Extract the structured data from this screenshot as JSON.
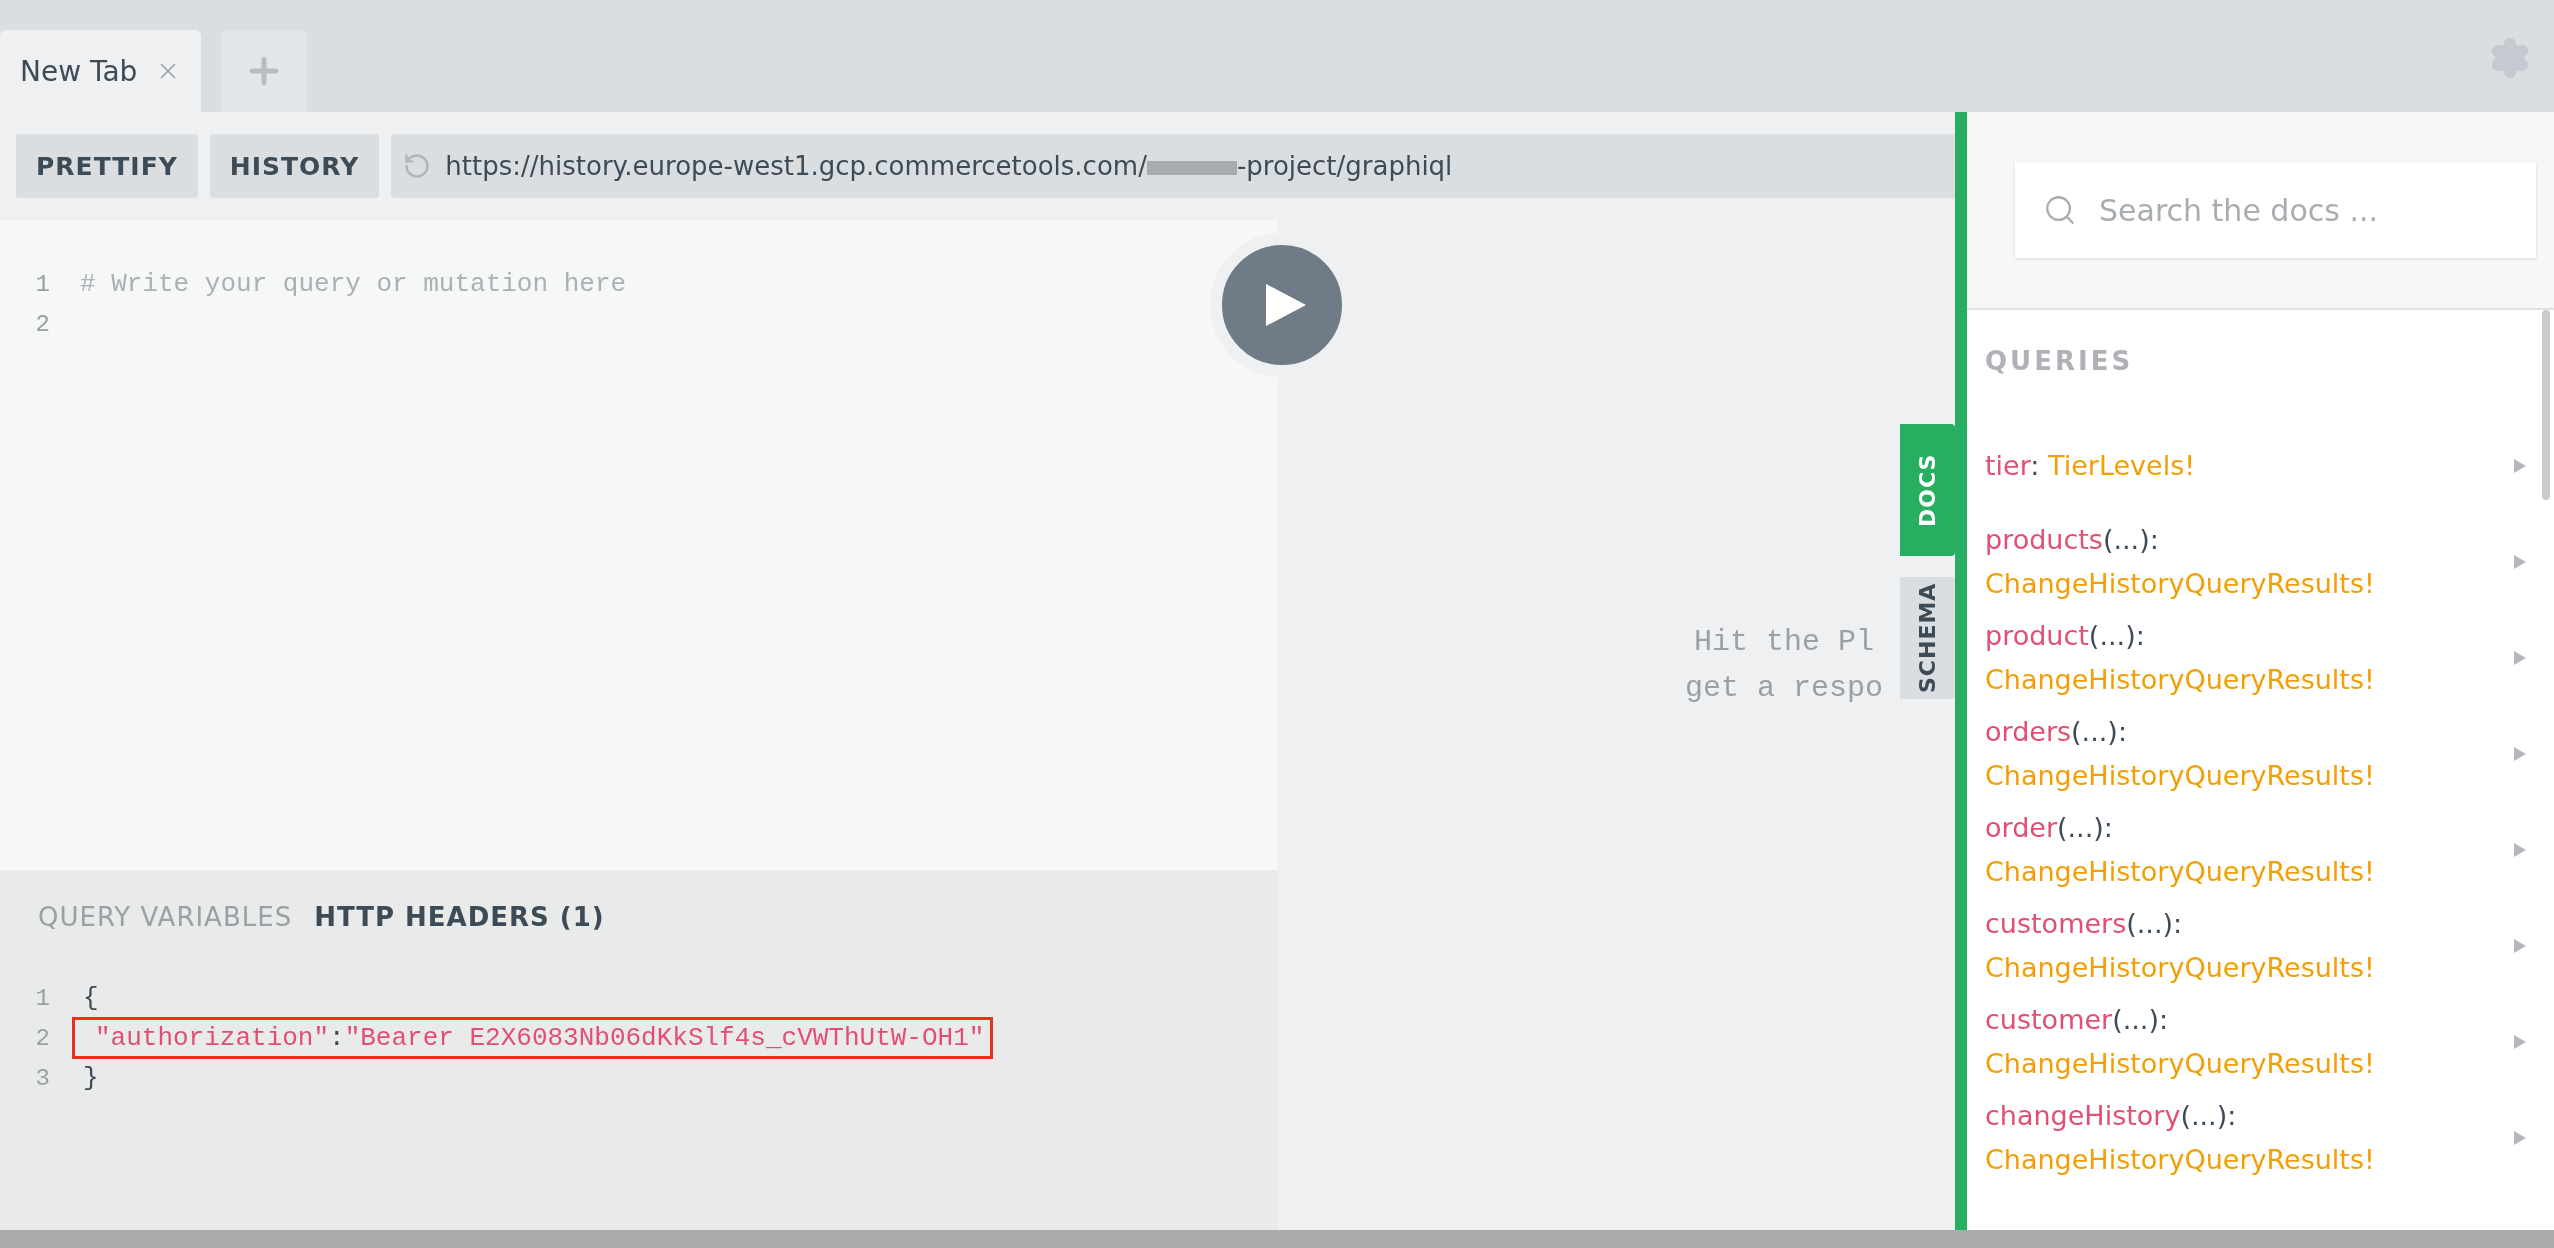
{
  "tabs": [
    {
      "label": "New Tab",
      "selected": true
    }
  ],
  "toolbar": {
    "buttons": [
      "PRETTIFY",
      "HISTORY"
    ],
    "url_start": "https://history.europe-west1.gcp.commercetools.com/",
    "url_end": "-project/graphiql"
  },
  "query_editor": {
    "lines": [
      {
        "number": "1",
        "text": "# Write your query or mutation here"
      },
      {
        "number": "2"
      }
    ]
  },
  "result": {
    "placeholder_lines": [
      "Hit the Pl",
      "get a respo"
    ]
  },
  "variables": {
    "tabs": [
      {
        "label": "QUERY VARIABLES",
        "selected": false
      },
      {
        "label": "HTTP HEADERS (1)",
        "selected": true
      }
    ],
    "lines": [
      {
        "number": "1",
        "highlighted": false,
        "tokens": [
          {
            "kind": "punct",
            "text": "{"
          }
        ]
      },
      {
        "number": "2",
        "highlighted": true,
        "tokens": [
          {
            "kind": "string",
            "text": "\"authorization\""
          },
          {
            "kind": "punct",
            "text": ":"
          },
          {
            "kind": "string",
            "text": "\"Bearer E2X6083Nb06dKkSlf4s_cVWThUtW-OH1\""
          }
        ]
      },
      {
        "number": "3",
        "highlighted": false,
        "tokens": [
          {
            "kind": "punct",
            "text": "}"
          }
        ]
      }
    ]
  },
  "side_tabs": [
    {
      "label": "DOCS",
      "selected": true
    },
    {
      "label": "SCHEMA",
      "selected": false
    }
  ],
  "docs": {
    "search": {
      "placeholder": "Search the docs ..."
    },
    "section": "QUERIES",
    "items": [
      {
        "name": "tier",
        "suffix": ":",
        "type": "TierLevels!"
      },
      {
        "name": "products",
        "suffix": "(...):",
        "type": "ChangeHistoryQueryResults!"
      },
      {
        "name": "product",
        "suffix": "(...):",
        "type": "ChangeHistoryQueryResults!"
      },
      {
        "name": "orders",
        "suffix": "(...):",
        "type": "ChangeHistoryQueryResults!"
      },
      {
        "name": "order",
        "suffix": "(...):",
        "type": "ChangeHistoryQueryResults!"
      },
      {
        "name": "customers",
        "suffix": "(...):",
        "type": "ChangeHistoryQueryResults!"
      },
      {
        "name": "customer",
        "suffix": "(...):",
        "type": "ChangeHistoryQueryResults!"
      },
      {
        "name": "changeHistory",
        "suffix": "(...):",
        "type": "ChangeHistoryQueryResults!"
      }
    ]
  }
}
